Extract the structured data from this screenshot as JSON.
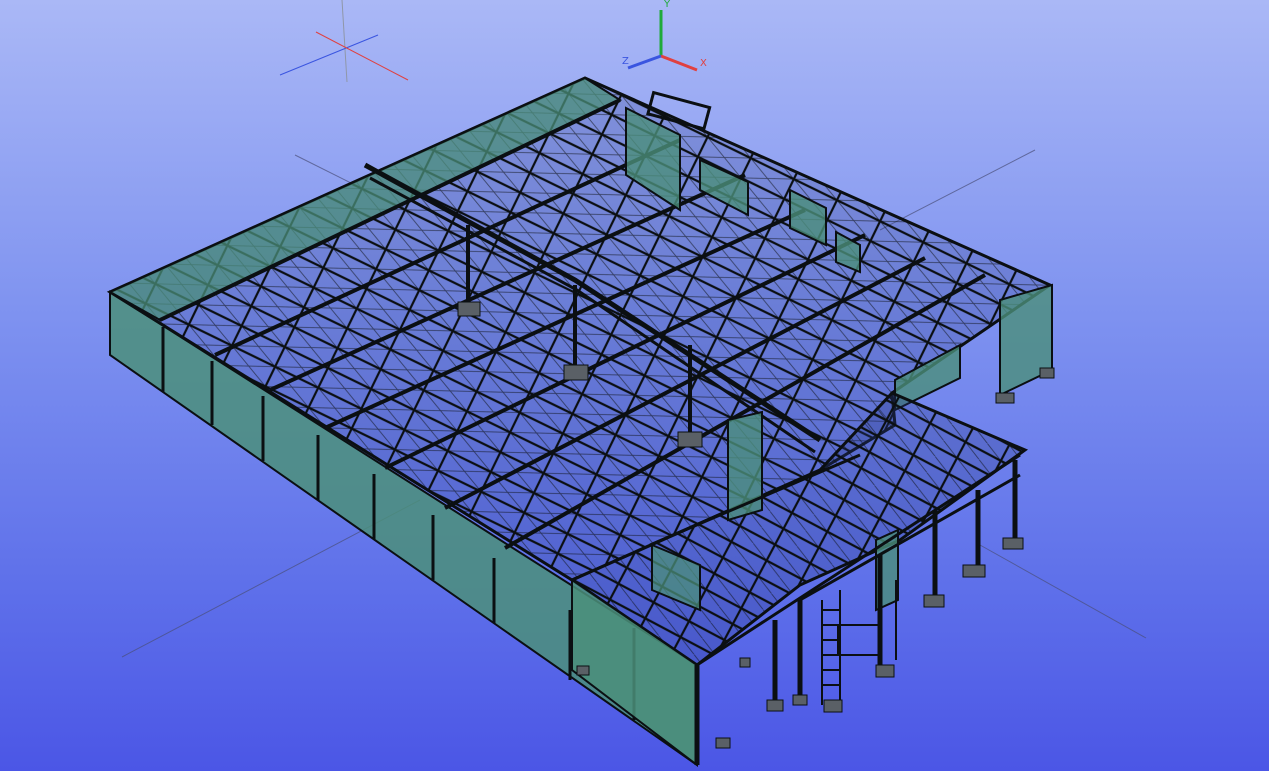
{
  "viewport": {
    "background_top": "#aab8f6",
    "background_bottom": "#4b56e6"
  },
  "axis_triad": {
    "x_label": "X",
    "y_label": "Y",
    "z_label": "Z",
    "x_color": "#e04040",
    "y_color": "#1faa3a",
    "z_color": "#3a55e0"
  },
  "model": {
    "panel_fill": "#4b8f7a",
    "steel_color": "#0b0f12",
    "footing_color": "#5a6066"
  }
}
